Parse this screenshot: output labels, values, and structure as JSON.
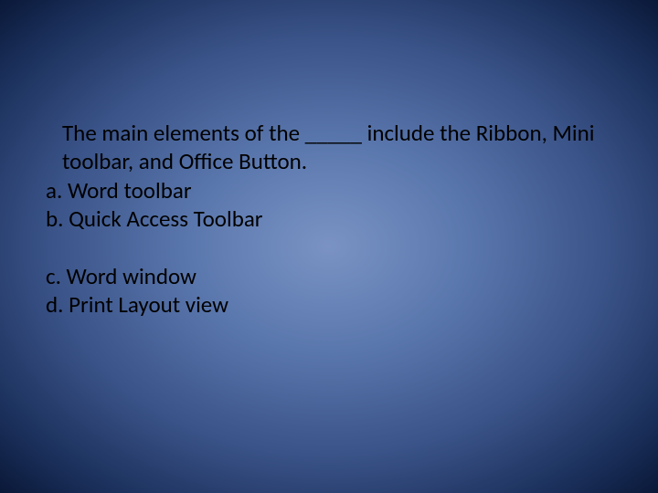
{
  "slide": {
    "question": "The main elements of the _____ include the Ribbon, Mini toolbar, and Office Button.",
    "options": {
      "a": "a. Word toolbar",
      "b": "b. Quick Access Toolbar",
      "c": "c. Word window",
      "d": "d. Print Layout view"
    }
  }
}
